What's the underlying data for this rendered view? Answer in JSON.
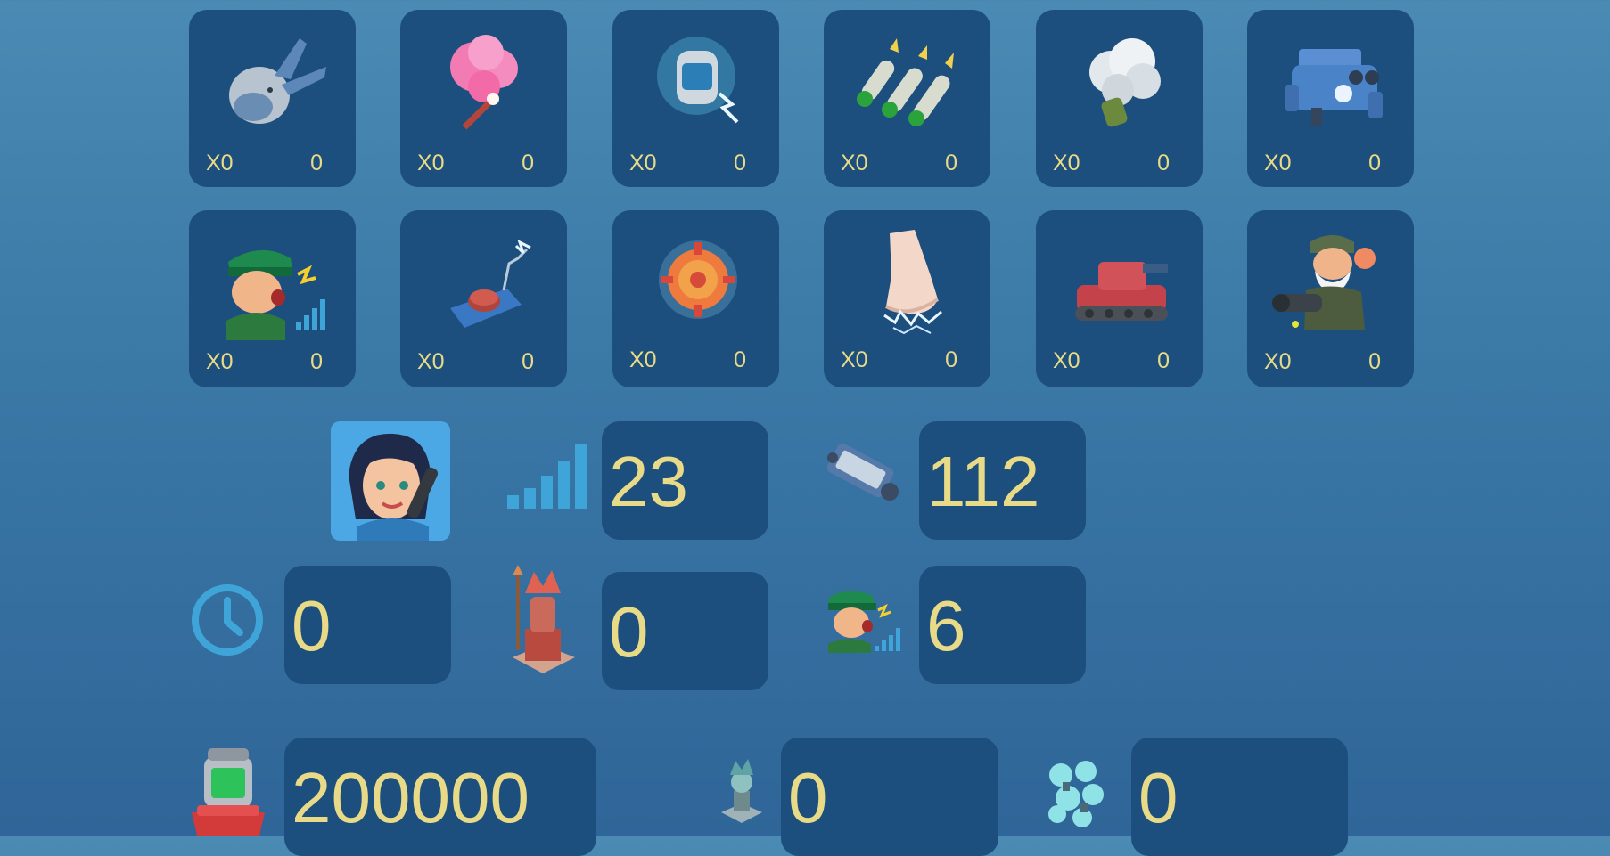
{
  "colors": {
    "panel": "#1c4f7e",
    "value_text": "#e8da86",
    "background": "#3a78a6",
    "signal": "#3fa5d8"
  },
  "inventory_row1": [
    {
      "name": "bomb-icon",
      "qty": "X0",
      "count": "0"
    },
    {
      "name": "flare-icon",
      "qty": "X0",
      "count": "0"
    },
    {
      "name": "shock-capsule-icon",
      "qty": "X0",
      "count": "0"
    },
    {
      "name": "missiles-icon",
      "qty": "X0",
      "count": "0"
    },
    {
      "name": "smoke-grenade-icon",
      "qty": "X0",
      "count": "0"
    },
    {
      "name": "mech-icon",
      "qty": "X0",
      "count": "0"
    }
  ],
  "inventory_row2": [
    {
      "name": "officer-shout-icon",
      "qty": "X0",
      "count": "0"
    },
    {
      "name": "detonator-icon",
      "qty": "X0",
      "count": "0"
    },
    {
      "name": "gear-shield-icon",
      "qty": "X0",
      "count": "0"
    },
    {
      "name": "electric-fist-icon",
      "qty": "X0",
      "count": "0"
    },
    {
      "name": "red-tank-icon",
      "qty": "X0",
      "count": "0"
    },
    {
      "name": "grenadier-hero-icon",
      "qty": "X0",
      "count": "0"
    }
  ],
  "stats": {
    "level": "23",
    "ammo": "112",
    "timer": "0",
    "statue": "0",
    "officer": "6",
    "gold": "200000",
    "idol": "0",
    "crystals": "0"
  }
}
